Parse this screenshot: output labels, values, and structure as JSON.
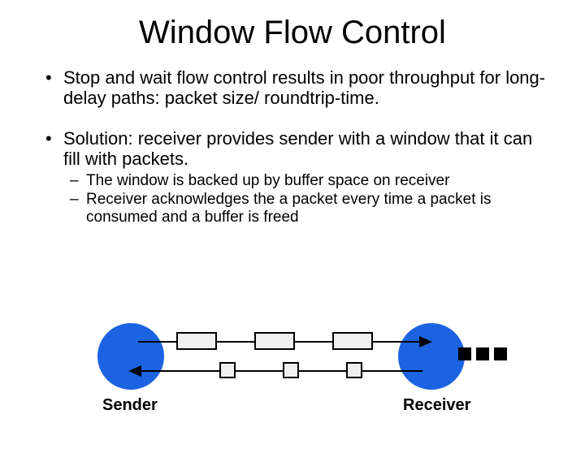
{
  "title": "Window Flow Control",
  "bullets": {
    "b1": "Stop and wait flow control results in poor throughput for long-delay paths:  packet size/ roundtrip-time.",
    "b2": "Solution: receiver provides sender with a window that it can fill with packets.",
    "sub1": "The window is backed up by buffer space on receiver",
    "sub2": "Receiver acknowledges the a packet every time a packet is consumed and a buffer is freed"
  },
  "diagram": {
    "sender_label": "Sender",
    "receiver_label": "Receiver"
  }
}
